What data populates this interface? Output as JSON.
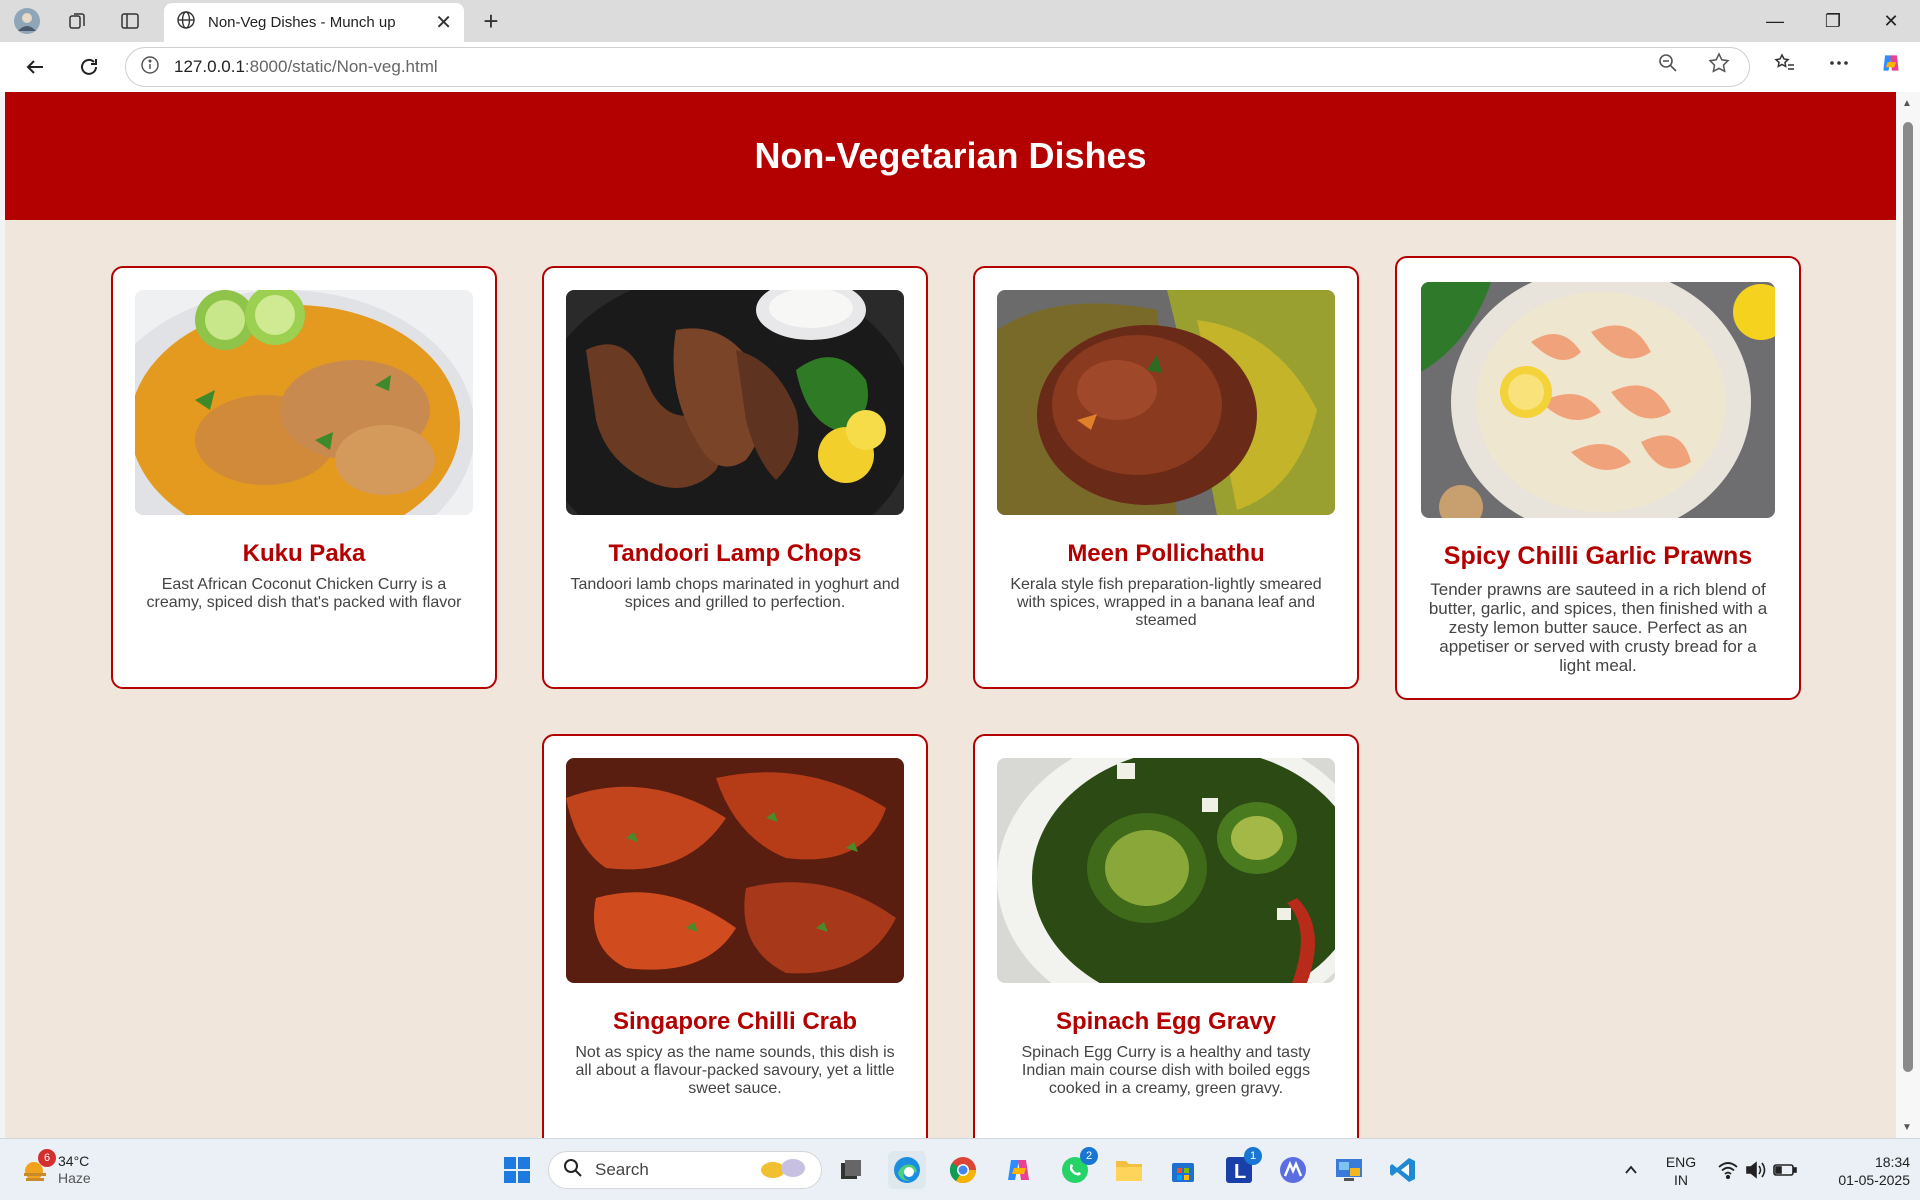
{
  "browser": {
    "tab_title": "Non-Veg Dishes - Munch up",
    "url_host": "127.0.0.1",
    "url_rest": ":8000/static/Non-veg.html"
  },
  "page": {
    "title": "Non-Vegetarian Dishes",
    "dishes": [
      {
        "name": "Kuku Paka",
        "description": "East African Coconut Chicken Curry is a creamy, spiced dish that's packed with flavor"
      },
      {
        "name": "Tandoori Lamp Chops",
        "description": "Tandoori lamb chops marinated in yoghurt and spices and grilled to perfection."
      },
      {
        "name": "Meen Pollichathu",
        "description": "Kerala style fish preparation-lightly smeared with spices, wrapped in a banana leaf and steamed"
      },
      {
        "name": "Spicy Chilli Garlic Prawns",
        "description": "Tender prawns are sauteed in a rich blend of butter, garlic, and spices, then finished with a zesty lemon butter sauce. Perfect as an appetiser or served with crusty bread for a light meal."
      },
      {
        "name": "Singapore Chilli Crab",
        "description": "Not as spicy as the name sounds, this dish is all about a flavour-packed savoury, yet a little sweet sauce."
      },
      {
        "name": "Spinach Egg Gravy",
        "description": "Spinach Egg Curry is a healthy and tasty Indian main course dish with boiled eggs cooked in a creamy, green gravy."
      }
    ]
  },
  "taskbar": {
    "weather_temp": "34°C",
    "weather_desc": "Haze",
    "weather_badge": "6",
    "search_label": "Search",
    "whatsapp_badge": "2",
    "app_badge": "1",
    "lang_top": "ENG",
    "lang_bottom": "IN",
    "time": "18:34",
    "date": "01-05-2025"
  },
  "colors": {
    "header": "#b30000",
    "background": "#f0e6dc",
    "dish_title": "#b30000"
  },
  "icons": [
    "profile-icon",
    "collections-icon",
    "tab-actions-icon",
    "globe-icon",
    "close-icon",
    "new-tab-icon",
    "back-icon",
    "refresh-icon",
    "info-icon",
    "zoom-icon",
    "star-icon",
    "favorites-icon",
    "more-icon",
    "copilot-icon"
  ]
}
